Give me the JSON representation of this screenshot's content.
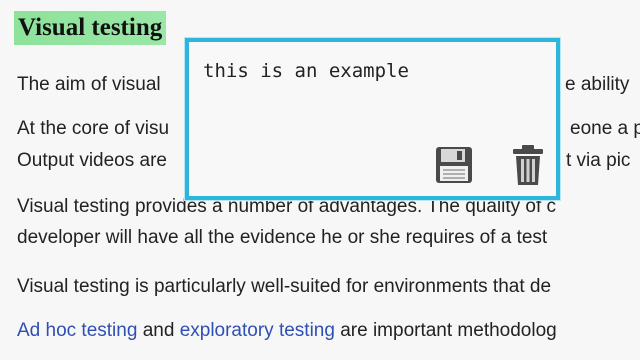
{
  "article": {
    "heading": "Visual testing",
    "lines": [
      "The aim of visual",
      "e ability",
      "At the core of visu",
      "eone a p",
      "Output videos are",
      "t via pic",
      "Visual testing provides a number of advantages. The quality of c",
      "developer will have all the evidence he or she requires of a test",
      "Visual testing is particularly well-suited for environments that de"
    ],
    "last_line": {
      "link1": "Ad hoc testing",
      "and": " and ",
      "link2": "exploratory testing",
      "rest": " are important methodolog"
    }
  },
  "note_popup": {
    "text": "this is an example",
    "save_icon": "floppy-disk-icon",
    "delete_icon": "trash-can-icon",
    "accent_color": "#2eb5dc"
  }
}
